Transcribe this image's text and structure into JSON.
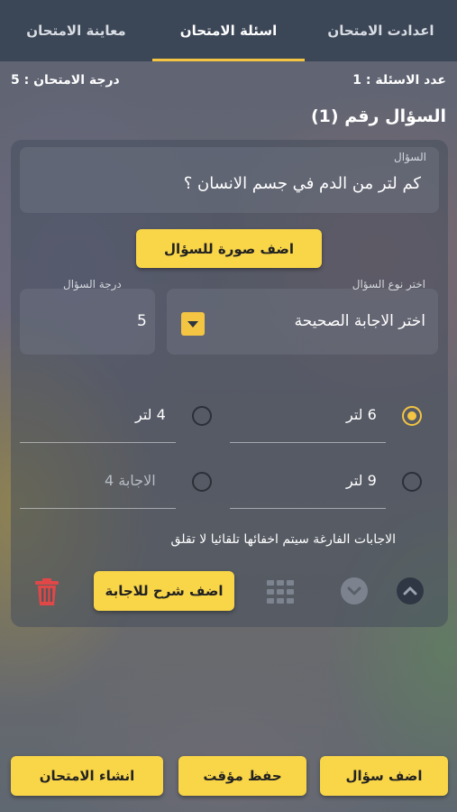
{
  "tabs": [
    {
      "label": "اعدادت الامتحان"
    },
    {
      "label": "اسئلة الامتحان"
    },
    {
      "label": "معاينة الامتحان"
    }
  ],
  "info": {
    "questions_count": "عدد الاسئلة : 1",
    "exam_grade": "درجة الامتحان : 5"
  },
  "question": {
    "title": "السؤال رقم (1)",
    "label": "السؤال",
    "text": "كم لتر من الدم في جسم الانسان ؟",
    "add_image": "اضف صورة للسؤال",
    "type_label": "اختر نوع السؤال",
    "type_value": "اختر الاجابة الصحيحة",
    "grade_label": "درجة السؤال",
    "grade_value": "5"
  },
  "answers": [
    {
      "text": "6 لتر",
      "selected": true
    },
    {
      "text": "4 لتر",
      "selected": false
    },
    {
      "text": "9 لتر",
      "selected": false
    },
    {
      "text": "",
      "placeholder": "الاجابة 4",
      "selected": false
    }
  ],
  "hint": "الاجابات الفارغة سيتم اخفائها تلقائيا لا تقلق",
  "toolbar": {
    "explain": "اضف شرح للاجابة"
  },
  "footer": {
    "add_question": "اضف سؤال",
    "save_temp": "حفظ مؤقت",
    "create_exam": "انشاء الامتحان"
  },
  "colors": {
    "accent": "#f4c542",
    "button": "#f9d548",
    "tabbar": "#3b4656",
    "delete": "#e04848"
  }
}
